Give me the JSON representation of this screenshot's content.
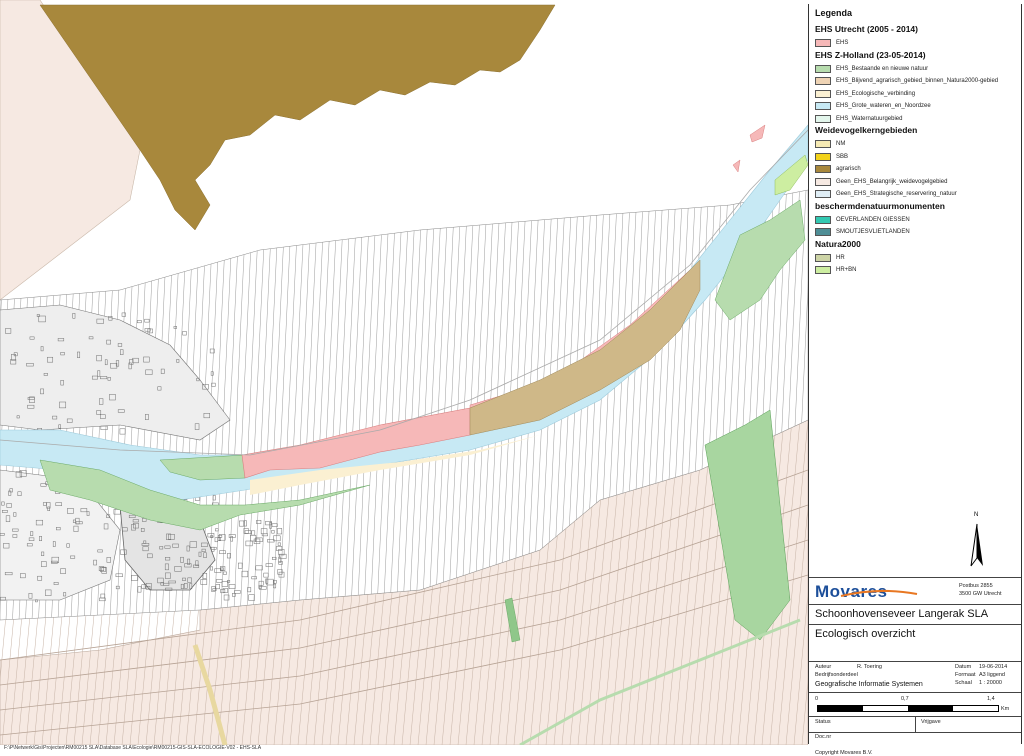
{
  "legend": {
    "title": "Legenda",
    "groups": [
      {
        "title": "EHS Utrecht (2005 - 2014)",
        "items": [
          {
            "label": "EHS",
            "color": "#f6b8b8"
          }
        ]
      },
      {
        "title": "EHS Z-Holland (23-05-2014)",
        "items": [
          {
            "label": "EHS_Bestaande en nieuwe natuur",
            "color": "#b7dcae"
          },
          {
            "label": "EHS_Blijvend_agrarisch_gebied_binnen_Natura2000-gebied",
            "color": "#eed3b4"
          },
          {
            "label": "EHS_Ecologische_verbinding",
            "color": "#fbf0d2"
          },
          {
            "label": "EHS_Grote_wateren_en_Noordzee",
            "color": "#c7e9f4"
          },
          {
            "label": "EHS_Waternatuurgebied",
            "color": "#e3f6ec"
          }
        ]
      },
      {
        "title": "Weidevogelkerngebieden",
        "items": [
          {
            "label": "NM",
            "color": "#f6eab4"
          },
          {
            "label": "SBB",
            "color": "#f2d21a"
          },
          {
            "label": "agrarisch",
            "color": "#a8883c"
          },
          {
            "label": "Geen_EHS_Belangrijk_weidevogelgebied",
            "color": "#f6e9e2"
          },
          {
            "label": "Geen_EHS_Strategische_reservering_natuur",
            "color": "#e0eef6"
          }
        ]
      },
      {
        "title": "beschermdenatuurmonumenten",
        "items": [
          {
            "label": "OEVERLANDEN GIESSEN",
            "color": "#33c9b2"
          },
          {
            "label": "SMOUTJESVLIETLANDEN",
            "color": "#4f8e96"
          }
        ]
      },
      {
        "title": "Natura2000",
        "items": [
          {
            "label": "HR",
            "color": "#cdd4a6"
          },
          {
            "label": "HR+BN",
            "color": "#cdeea1"
          }
        ]
      }
    ]
  },
  "north_arrow": {
    "label": "N"
  },
  "title_block": {
    "company": "Movares",
    "address_line1": "Postbus 2855",
    "address_line2": "3500 GW Utrecht",
    "project": "Schoonhovenseveer Langerak SLA",
    "subtitle": "Ecologisch overzicht",
    "author_label": "Auteur",
    "author_value": "R. Toering",
    "unit_label": "Bedrijfsonderdeel",
    "unit_value": "Geografische Informatie Systemen",
    "date_label": "Datum",
    "date_value": "19-06-2014",
    "format_label": "Formaat",
    "format_value": "A3 liggend",
    "scale_label": "Schaal",
    "scale_value": "1 : 20000",
    "scalebar_ticks": [
      "0",
      "0,7",
      "1,4"
    ],
    "scalebar_unit": "Km",
    "status_label": "Status",
    "release_label": "Vrijgave",
    "docnr_label": "Doc.nr",
    "copyright": "Copyright Movares B.V."
  },
  "footer_path": "F:\\P\\Netwerk\\Gis\\Projecten\\RM00215 SLA\\Database SLA\\Ecologie\\RM00215-GIS-SLA-ECOLOGIE-V02 - EHS-SLA",
  "colors": {
    "river": "#c7e9f4",
    "ehs_utrecht": "#f6b8b8",
    "agrarisch": "#a8883c",
    "agrarisch_light": "#cfb888",
    "nature": "#b7dcae",
    "nature_dark": "#8fc78a",
    "farmland": "#f6e9e2",
    "hr_bn": "#cdeea1",
    "lines": "#7a7a7a"
  }
}
